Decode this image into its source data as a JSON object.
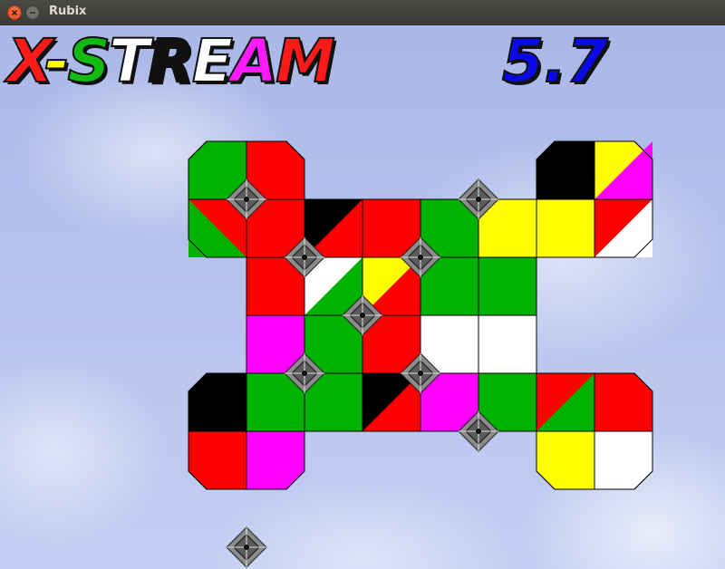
{
  "window": {
    "title": "Rubix"
  },
  "game": {
    "title_letters": [
      {
        "ch": "X",
        "color": "#ff1a1a"
      },
      {
        "ch": "-",
        "color": "#ffff00"
      },
      {
        "ch": "S",
        "color": "#11bb11"
      },
      {
        "ch": "T",
        "color": "#ffffff"
      },
      {
        "ch": "R",
        "color": "#111111"
      },
      {
        "ch": "E",
        "color": "#ffffff"
      },
      {
        "ch": "A",
        "color": "#ff1aff"
      },
      {
        "ch": "M",
        "color": "#ff1a1a"
      },
      {
        "ch": "",
        "color": "#ffff00"
      }
    ],
    "version": "5.7",
    "version_color": "#0a0ae6",
    "palette": {
      "g": "#00b200",
      "r": "#ff0000",
      "k": "#000000",
      "w": "#ffffff",
      "y": "#ffff00",
      "m": "#ff00ff"
    },
    "pieces": [
      {
        "id": "tl",
        "quads": [
          "g",
          "r",
          "r",
          "r"
        ],
        "split": {
          "3": [
            "r",
            "g"
          ]
        }
      },
      {
        "id": "tr",
        "quads": [
          "k",
          "y",
          "y",
          "w"
        ],
        "split": {
          "1": [
            "y",
            "m"
          ],
          "3": [
            "r",
            "w"
          ]
        }
      },
      {
        "id": "bl",
        "quads": [
          "k",
          "g",
          "r",
          "m"
        ]
      },
      {
        "id": "br",
        "quads": [
          "r",
          "r",
          "y",
          "w"
        ],
        "split": {
          "0": [
            "r",
            "g"
          ]
        }
      }
    ],
    "grid": [
      [
        "g",
        "r",
        "",
        "",
        "",
        "",
        "k",
        "y"
      ],
      [
        "r",
        "r",
        "k",
        "r",
        "g",
        "y",
        "y",
        "r"
      ],
      [
        "",
        "r",
        "w",
        "y",
        "g",
        "g",
        "",
        ""
      ],
      [
        "",
        "m",
        "g",
        "r",
        "w",
        "w",
        "",
        ""
      ],
      [
        "k",
        "g",
        "g",
        "k",
        "m",
        "g",
        "r",
        "r"
      ],
      [
        "r",
        "m",
        "",
        "",
        "",
        "",
        "y",
        "w"
      ]
    ]
  }
}
